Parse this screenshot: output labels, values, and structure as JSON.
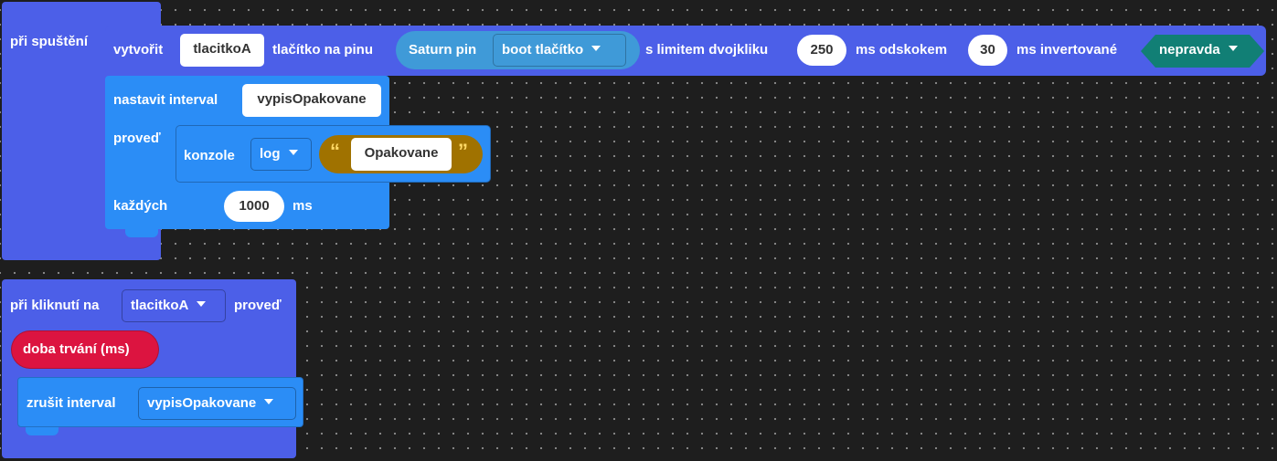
{
  "colors": {
    "event_block": "#4c5fe8",
    "action_block": "#2b8df6",
    "saturn_pill": "#3f9ad8",
    "boolean_block": "#117f75",
    "text_block": "#a07200",
    "duration_block": "#dc1440"
  },
  "start_event": {
    "label": "při spuštění"
  },
  "create_button": {
    "label_create": "vytvořit",
    "name_value": "tlacitkoA",
    "label_on_pin": "tlačítko na pinu",
    "saturn_label": "Saturn pin",
    "pin_value": "boot tlačítko",
    "label_double_click": "s limitem dvojkliku",
    "double_click_value": "250",
    "label_debounce": "ms odskokem",
    "debounce_value": "30",
    "label_inverted": "ms invertované",
    "inverted_value": "nepravda"
  },
  "set_interval": {
    "label": "nastavit interval",
    "name_value": "vypisOpakovane",
    "label_do": "proveď",
    "console_label": "konzole",
    "console_method": "log",
    "quote_open": "“",
    "text_value": "Opakovane",
    "quote_close": "”",
    "label_every": "každých",
    "every_value": "1000",
    "label_ms": "ms"
  },
  "click_event": {
    "label": "při kliknutí na",
    "button_value": "tlacitkoA",
    "label_do": "proveď",
    "duration_label": "doba trvání (ms)"
  },
  "clear_interval": {
    "label": "zrušit interval",
    "name_value": "vypisOpakovane"
  },
  "icons": {
    "dropdown": "chevron-down-icon"
  }
}
